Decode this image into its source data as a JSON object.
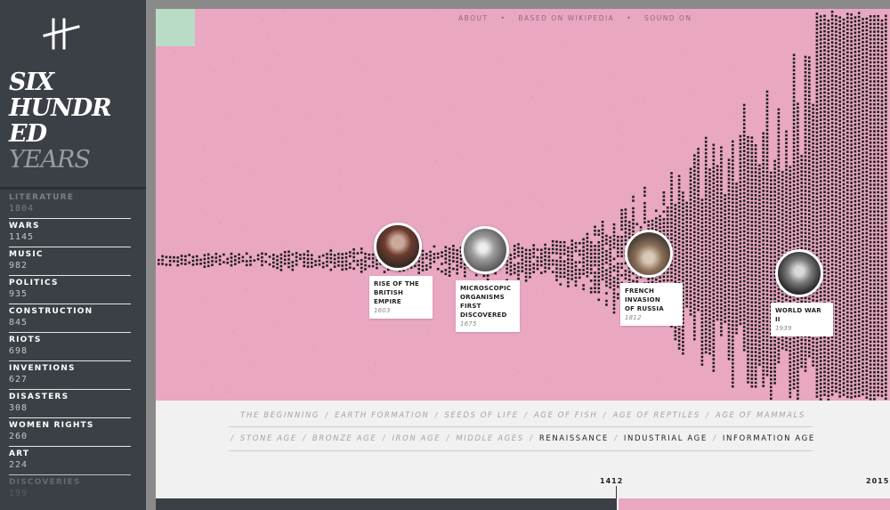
{
  "app": {
    "title_lines": [
      "SIX",
      "HUNDR",
      "ED",
      "YEARS"
    ],
    "logo_icon": "tuning-fork-logo-icon"
  },
  "categories": [
    {
      "name": "LITERATURE",
      "count": "1804",
      "dim": true
    },
    {
      "name": "WARS",
      "count": "1145",
      "dim": false
    },
    {
      "name": "MUSIC",
      "count": "982",
      "dim": false
    },
    {
      "name": "POLITICS",
      "count": "935",
      "dim": false
    },
    {
      "name": "CONSTRUCTION",
      "count": "845",
      "dim": false
    },
    {
      "name": "RIOTS",
      "count": "698",
      "dim": false
    },
    {
      "name": "INVENTIONS",
      "count": "627",
      "dim": false
    },
    {
      "name": "DISASTERS",
      "count": "308",
      "dim": false
    },
    {
      "name": "WOMEN RIGHTS",
      "count": "260",
      "dim": false
    },
    {
      "name": "ART",
      "count": "224",
      "dim": false
    },
    {
      "name": "DISCOVERIES",
      "count": "199",
      "dim": true
    }
  ],
  "topnav": {
    "about": "ABOUT",
    "wikipedia": "BASED ON WIKIPEDIA",
    "sound": "SOUND ON"
  },
  "events": [
    {
      "title_lines": [
        "RISE OF THE",
        "BRITISH EMPIRE"
      ],
      "year": "1603"
    },
    {
      "title_lines": [
        "MICROSCOPIC",
        "ORGANISMS FIRST",
        "DISCOVERED"
      ],
      "year": "1675"
    },
    {
      "title_lines": [
        "FRENCH INVASION",
        "OF RUSSIA"
      ],
      "year": "1812"
    },
    {
      "title_lines": [
        "WORLD WAR II"
      ],
      "year": "1939"
    }
  ],
  "eras": {
    "row1": [
      "THE BEGINNING",
      "EARTH FORMATION",
      "SEEDS OF LIFE",
      "AGE OF FISH",
      "AGE OF REPTILES",
      "AGE OF MAMMALS"
    ],
    "row2": [
      "STONE AGE",
      "BRONZE AGE",
      "IRON AGE",
      "MIDDLE AGES",
      "RENAISSANCE",
      "INDUSTRIAL AGE",
      "INFORMATION AGE"
    ],
    "current": [
      "RENAISSANCE",
      "INDUSTRIAL AGE",
      "INFORMATION AGE"
    ]
  },
  "timeline": {
    "start": "1412",
    "end": "2015"
  },
  "colors": {
    "pink": "#e9a7c2",
    "mint": "#b8dcc6",
    "sidebar": "#3b3f46",
    "dots": "#1e1e1e"
  }
}
